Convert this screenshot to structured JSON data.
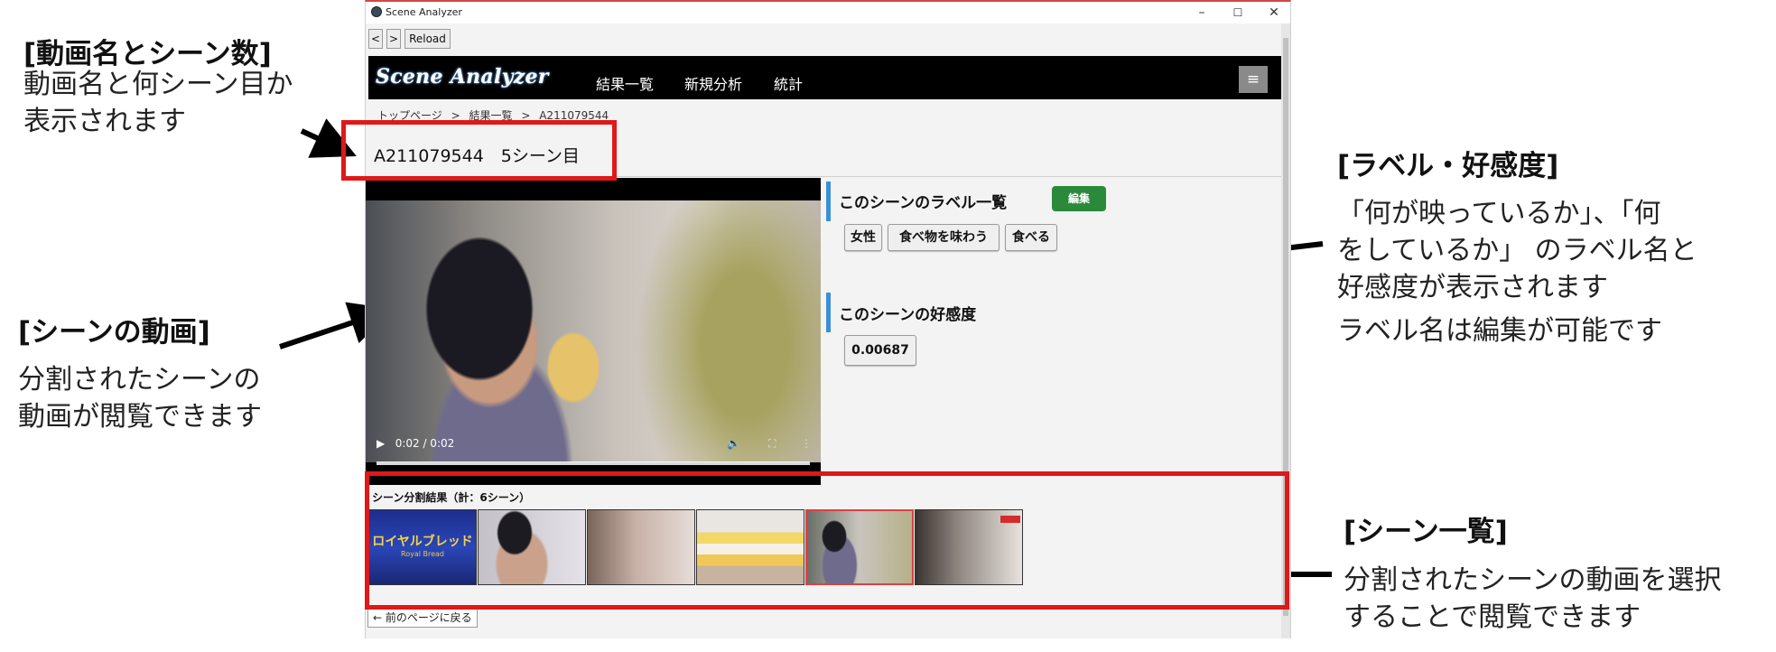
{
  "annotations": {
    "name": {
      "title": "[動画名とシーン数]",
      "lines": [
        "動画名と何シーン目か",
        "表示されます"
      ]
    },
    "video": {
      "title": "[シーンの動画]",
      "lines": [
        "分割されたシーンの",
        "動画が閲覧できます"
      ]
    },
    "labels": {
      "title": "[ラベル・好感度]",
      "lines": [
        "「何が映っているか」、「何",
        "をしているか」 のラベル名と",
        "好感度が表示されます"
      ],
      "note": "ラベル名は編集が可能です"
    },
    "scenes": {
      "title": "[シーン一覧]",
      "lines": [
        "分割されたシーンの動画を選択",
        "することで閲覧できます"
      ]
    }
  },
  "window": {
    "title": "Scene Analyzer",
    "controls": [
      "–",
      "☐",
      "✕"
    ]
  },
  "navbar": {
    "back": "<",
    "forward": ">",
    "reload": "Reload"
  },
  "header": {
    "logo": "Scene Analyzer",
    "nav": [
      "結果一覧",
      "新規分析",
      "統計"
    ],
    "menu_icon": "≡"
  },
  "breadcrumb": [
    "トップページ",
    ">",
    "結果一覧",
    ">",
    "A211079544"
  ],
  "scene_title": "A211079544　5シーン目",
  "video": {
    "time": "0:02 / 0:02"
  },
  "labels_section": {
    "title": "このシーンのラベル一覧",
    "edit": "編集",
    "chips": [
      "女性",
      "食べ物を味わう",
      "食べる"
    ]
  },
  "score_section": {
    "title": "このシーンの好感度",
    "value": "0.00687"
  },
  "scene_list": {
    "heading": "シーン分割結果（計：6シーン）",
    "thumb1_text": "ロイヤルブレッド",
    "thumb1_sub": "Royal Bread"
  },
  "back_button": "← 前のページに戻る",
  "colors": {
    "highlight": "#e01818",
    "accent_bar": "#3a8fd6",
    "edit_button": "#2a8a3a",
    "header_bg": "#000000"
  }
}
